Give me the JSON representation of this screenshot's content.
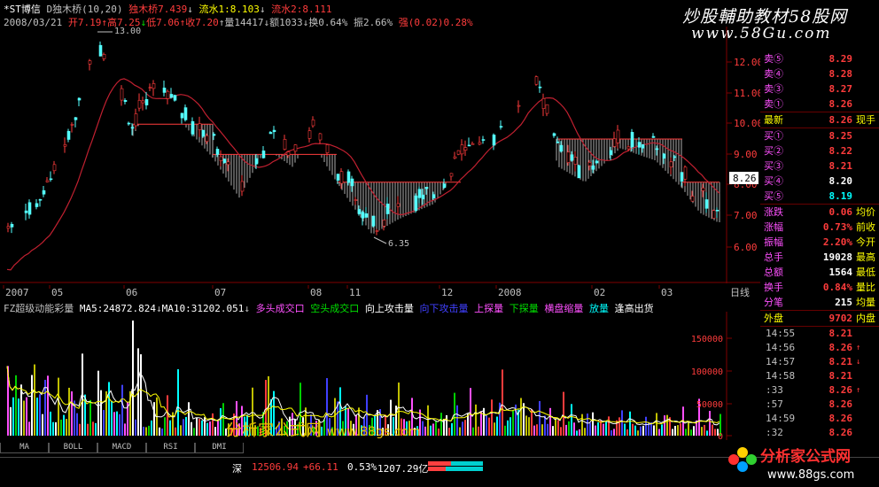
{
  "header": {
    "stock_name": "*ST博信",
    "indicator": "D独木桥(10,20)",
    "dmq_label": "独木桥",
    "dmq_value": "7.439",
    "ls1_label": "流水1",
    "ls1_value": "8.103",
    "ls2_label": "流水2",
    "ls2_value": "8.111",
    "date": "2008/03/21",
    "open_label": "开",
    "open": "7.19",
    "high_label": "高",
    "high": "7.25",
    "low_label": "低",
    "low": "7.06",
    "close_label": "收",
    "close": "7.20",
    "vol_label": "量",
    "vol": "14417",
    "amt_label": "额",
    "amt": "1033",
    "turn_label": "换",
    "turn": "0.64%",
    "amp_label": "振",
    "amp": "2.66%",
    "strength_label": "强",
    "strength": "(0.02)",
    "strength_pct": "0.28%"
  },
  "brand": {
    "title": "炒股輔助教材58股网",
    "url": "www.58Gu.com"
  },
  "price_axis": [
    "12.00",
    "11.00",
    "10.00",
    "9.00",
    "8.00",
    "7.00",
    "6.00"
  ],
  "current_price_tag": "8.26",
  "annotations": {
    "high": "13.00",
    "low": "6.35"
  },
  "x_axis": [
    "2007",
    "05",
    "06",
    "07",
    "08",
    "11",
    "12",
    "2008",
    "02",
    "03"
  ],
  "period_label": "日线",
  "volume_indicator": {
    "name": "FZ超级动能彩量",
    "ma5_label": "MA5:",
    "ma5": "24872.824",
    "ma10_label": "MA10:",
    "ma10": "31202.051",
    "legend": [
      "多头成交口",
      "空头成交口",
      "向上攻击量",
      "向下攻击量",
      "上探量",
      "下探量",
      "横盘缩量",
      "放量",
      "逢高出货"
    ]
  },
  "volume_axis": [
    "150000",
    "100000",
    "50000",
    "0"
  ],
  "tabs": [
    "MA",
    "BOLL",
    "MACD",
    "RSI",
    "DMI"
  ],
  "status": {
    "market": "深",
    "index": "12506.94",
    "change": "+66.11",
    "pct": "0.53%",
    "turnover": "1207.29亿"
  },
  "quote": {
    "asks": [
      {
        "label": "卖⑤",
        "price": "8.29"
      },
      {
        "label": "卖④",
        "price": "8.28"
      },
      {
        "label": "卖③",
        "price": "8.27"
      },
      {
        "label": "卖①",
        "price": "8.26"
      }
    ],
    "latest": {
      "label": "最新",
      "price": "8.26",
      "extra": "现手"
    },
    "bids": [
      {
        "label": "买①",
        "price": "8.25"
      },
      {
        "label": "买②",
        "price": "8.22"
      },
      {
        "label": "买③",
        "price": "8.21"
      },
      {
        "label": "买④",
        "price": "8.20"
      },
      {
        "label": "买⑤",
        "price": "8.19"
      }
    ],
    "stats": [
      {
        "label": "涨跌",
        "value": "0.06",
        "extra": "均价"
      },
      {
        "label": "涨幅",
        "value": "0.73%",
        "extra": "前收"
      },
      {
        "label": "振幅",
        "value": "2.20%",
        "extra": "今开"
      },
      {
        "label": "总手",
        "value": "19028",
        "extra": "最高"
      },
      {
        "label": "总额",
        "value": "1564",
        "extra": "最低"
      },
      {
        "label": "换手",
        "value": "0.84%",
        "extra": "量比"
      },
      {
        "label": "分笔",
        "value": "215",
        "extra": "均量"
      }
    ],
    "outer_label": "外盘",
    "outer_value": "9702",
    "inner_label": "内盘",
    "ticks": [
      {
        "time": "14:55",
        "price": "8.21",
        "arrow": ""
      },
      {
        "time": "14:56",
        "price": "8.26",
        "arrow": "↑"
      },
      {
        "time": "14:57",
        "price": "8.21",
        "arrow": "↓"
      },
      {
        "time": "14:58",
        "price": "8.21",
        "arrow": ""
      },
      {
        "time": ":33",
        "price": "8.26",
        "arrow": "↑"
      },
      {
        "time": ":57",
        "price": "8.26",
        "arrow": ""
      },
      {
        "time": "14:59",
        "price": "8.26",
        "arrow": ""
      },
      {
        "time": ":32",
        "price": "8.26",
        "arrow": ""
      }
    ]
  },
  "watermarks": {
    "fxj": "分析家公式网",
    "fxj_url": "www.88gs.com",
    "logo_title": "分析家公式网",
    "logo_url": "www.88gs.com"
  }
}
